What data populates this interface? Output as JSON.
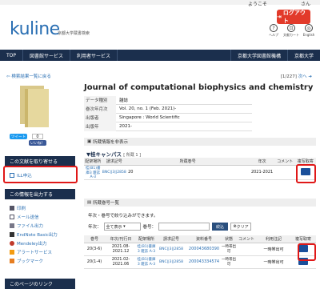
{
  "header": {
    "welcome": "ようこそ　　　　　　　さん",
    "logo": "kuline",
    "logo_sub": "京都大学蔵書検索",
    "logout": "ログアウト",
    "icons": [
      {
        "name": "help-icon",
        "glyph": "?",
        "label": "ヘルプ"
      },
      {
        "name": "cart-icon",
        "glyph": "⊡",
        "label": "文献カート"
      },
      {
        "name": "english-icon",
        "glyph": "◎",
        "label": "English"
      }
    ]
  },
  "nav": {
    "left": [
      "TOP",
      "図書館サービス",
      "利用者サービス"
    ],
    "right": [
      "京都大学図書館機構",
      "京都大学"
    ]
  },
  "breadcrumb": {
    "back": "検索結果一覧に戻る",
    "pager": "[1/227]",
    "next": "次へ ➔"
  },
  "record": {
    "title": "Journal of computational biophysics and chemistry",
    "meta": [
      {
        "k": "データ種別",
        "v": "雑誌"
      },
      {
        "k": "巻次年月次",
        "v": "Vol. 20, no. 1 (Feb. 2021)-"
      },
      {
        "k": "出版者",
        "v": "Singapore : World Scientific"
      },
      {
        "k": "出版年",
        "v": "2021-"
      }
    ]
  },
  "social": {
    "tweet": "ツイート",
    "count": "0",
    "like": "いいね！"
  },
  "sidebar": {
    "order_head": "この文献を取り寄せる",
    "ill": "ILL申込",
    "output_head": "この情報を出力する",
    "output_items": [
      "印刷",
      "メール送信",
      "ファイル出力",
      "EndNote Basic出力",
      "Mendeley出力",
      "アラートサービス",
      "ブックマーク"
    ],
    "link_head": "このページのリンク"
  },
  "holdings": {
    "toggle": "所蔵情報を非表示",
    "campus": "▼桂キャンパス",
    "campus_count": "[ 所蔵 1 ]",
    "headers": [
      "配架場所",
      "請求記号",
      "所蔵巻号",
      "年次",
      "コメント",
      "複写取寄"
    ],
    "row": {
      "loc": "桂(B1)書庫3 雑誌 A-3",
      "call": "BNC||3||2858",
      "vol": "20",
      "year": "2021-2021",
      "comment": ""
    }
  },
  "volumes": {
    "bar": "所蔵巻号一覧",
    "filter_desc": "年次・巻号で絞り込みができます。",
    "year_label": "年次：",
    "year_select": "全て表示",
    "vol_label": "巻号：",
    "filter_btn": "絞込",
    "clear_btn": "クリア",
    "headers": [
      "巻号",
      "年次/刊行日",
      "配架場所",
      "請求記号",
      "資料番号",
      "状態",
      "コメント",
      "利用注記",
      "複写取寄"
    ],
    "rows": [
      {
        "vol": "20(3-6)",
        "date": "2021.08-2021.12",
        "loc": "桂(B1)書庫3 雑誌 A-3",
        "call": "BNC||3||2858",
        "id": "200043680390",
        "status": "一時帯出可",
        "comment": "",
        "note": "一時帯出可"
      },
      {
        "vol": "20(1-4)",
        "date": "2021.02-2021.06",
        "loc": "桂(B1)書庫3 雑誌 A-3",
        "call": "BNC||3||2858",
        "id": "200043334574",
        "status": "一時帯出可",
        "comment": "",
        "note": "一時帯出可"
      }
    ]
  }
}
